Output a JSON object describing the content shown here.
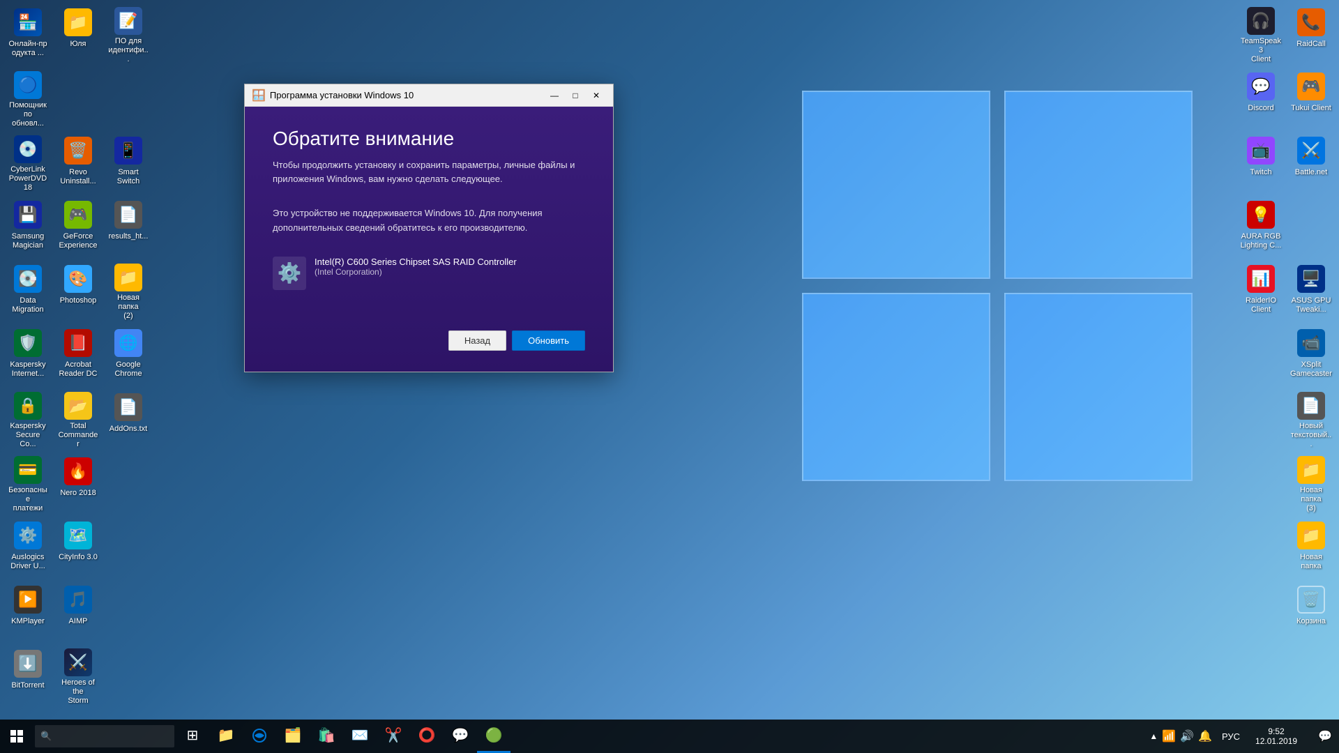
{
  "desktop": {
    "background_color": "#1a3a5c"
  },
  "icons_left": [
    {
      "id": "online",
      "label": "Онлайн-пр\nодукта ...",
      "emoji": "🏪",
      "color": "#003087"
    },
    {
      "id": "yulya",
      "label": "Юля",
      "emoji": "📁",
      "color": "#ffb900"
    },
    {
      "id": "software",
      "label": "ПО для\nидентифи...",
      "emoji": "🔑",
      "color": "#0078d7"
    },
    {
      "id": "helper",
      "label": "Помощник\nпо обновл...",
      "emoji": "🔵",
      "color": "#0078d7"
    },
    {
      "id": "empty1",
      "label": "",
      "emoji": "",
      "color": ""
    },
    {
      "id": "empty2",
      "label": "",
      "emoji": "",
      "color": ""
    },
    {
      "id": "cyberdvd",
      "label": "CyberLink\nPowerDVD 18",
      "emoji": "💿",
      "color": "#003087"
    },
    {
      "id": "revo",
      "label": "Revo\nUninstall...",
      "emoji": "🗑️",
      "color": "#e65c00"
    },
    {
      "id": "smartswitch",
      "label": "Smart Switch",
      "emoji": "📱",
      "color": "#1428a0"
    },
    {
      "id": "samsung",
      "label": "Samsung\nMagician",
      "emoji": "💾",
      "color": "#1428a0"
    },
    {
      "id": "geforce",
      "label": "GeForce\nExperience",
      "emoji": "🎮",
      "color": "#76b900"
    },
    {
      "id": "results",
      "label": "results_ht...",
      "emoji": "📄",
      "color": "#777"
    },
    {
      "id": "datamig",
      "label": "Data\nMigration",
      "emoji": "💽",
      "color": "#0078d7"
    },
    {
      "id": "photoshop",
      "label": "Photoshop",
      "emoji": "🎨",
      "color": "#31a8ff"
    },
    {
      "id": "newfolder2",
      "label": "Новая папка\n(2)",
      "emoji": "📁",
      "color": "#ffb900"
    },
    {
      "id": "kaspersky",
      "label": "Kaspersky\nInternet...",
      "emoji": "🛡️",
      "color": "#006d32"
    },
    {
      "id": "acrobat",
      "label": "Acrobat\nReader DC",
      "emoji": "📕",
      "color": "#b30b00"
    },
    {
      "id": "chrome",
      "label": "Google\nChrome",
      "emoji": "🌐",
      "color": "#0078d7"
    },
    {
      "id": "kaspersky2",
      "label": "Kaspersky\nSecure Co...",
      "emoji": "🔒",
      "color": "#006d32"
    },
    {
      "id": "total",
      "label": "Total\nCommander",
      "emoji": "📂",
      "color": "#f5c518"
    },
    {
      "id": "addons",
      "label": "AddOns.txt",
      "emoji": "📄",
      "color": "#777"
    },
    {
      "id": "bezop",
      "label": "Безопасные\nплатежи",
      "emoji": "💳",
      "color": "#006d32"
    },
    {
      "id": "nero",
      "label": "Nero 2018",
      "emoji": "🔥",
      "color": "#cc0000"
    },
    {
      "id": "empty3",
      "label": "",
      "emoji": "",
      "color": ""
    },
    {
      "id": "auslogics",
      "label": "Auslogics\nDriver U...",
      "emoji": "⚙️",
      "color": "#0078d7"
    },
    {
      "id": "cityinfo",
      "label": "CityInfo 3.0",
      "emoji": "🗺️",
      "color": "#00b4d8"
    },
    {
      "id": "empty4",
      "label": "",
      "emoji": "",
      "color": ""
    },
    {
      "id": "kmplayer",
      "label": "KMPlayer",
      "emoji": "▶️",
      "color": "#333"
    },
    {
      "id": "aimp",
      "label": "AIMP",
      "emoji": "🎵",
      "color": "#005fad"
    },
    {
      "id": "empty5",
      "label": "",
      "emoji": "",
      "color": ""
    },
    {
      "id": "bittorrent",
      "label": "BitTorrent",
      "emoji": "⬇️",
      "color": "#777"
    },
    {
      "id": "heroes",
      "label": "Heroes of the\nStorm",
      "emoji": "⚔️",
      "color": "#1a1a3a"
    }
  ],
  "icons_right": [
    {
      "id": "teamspeak",
      "label": "TeamSpeak 3\nClient",
      "emoji": "🎧",
      "color": "#1e1e2e"
    },
    {
      "id": "raidcall",
      "label": "RaidCall",
      "emoji": "📞",
      "color": "#e65c00"
    },
    {
      "id": "discord",
      "label": "Discord",
      "emoji": "💬",
      "color": "#5865f2"
    },
    {
      "id": "tukui",
      "label": "Tukui Client",
      "emoji": "🎮",
      "color": "#ff8c00"
    },
    {
      "id": "twitch",
      "label": "Twitch",
      "emoji": "📺",
      "color": "#9146ff"
    },
    {
      "id": "battlenet",
      "label": "Battle.net",
      "emoji": "⚔️",
      "color": "#0074e0"
    },
    {
      "id": "aura",
      "label": "AURA RGB\nLighting C...",
      "emoji": "💡",
      "color": "#cc0000"
    },
    {
      "id": "empty_r1",
      "label": "",
      "emoji": "",
      "color": ""
    },
    {
      "id": "raiderio",
      "label": "RaiderIO\nClient",
      "emoji": "📊",
      "color": "#e81123"
    },
    {
      "id": "asusgpu",
      "label": "ASUS GPU\nTweaki...",
      "emoji": "🖥️",
      "color": "#003087"
    },
    {
      "id": "empty_r2",
      "label": "",
      "emoji": "",
      "color": ""
    },
    {
      "id": "xsplit",
      "label": "XSplit\nGamecaster",
      "emoji": "📹",
      "color": "#005fad"
    },
    {
      "id": "empty_r3",
      "label": "",
      "emoji": "",
      "color": ""
    },
    {
      "id": "newfolder3_item",
      "label": "Новый\nтекстовый...",
      "emoji": "📄",
      "color": "#777"
    },
    {
      "id": "empty_r4",
      "label": "",
      "emoji": "",
      "color": ""
    },
    {
      "id": "newfolder_r",
      "label": "Новая папка\n(3)",
      "emoji": "📁",
      "color": "#ffb900"
    },
    {
      "id": "empty_r5",
      "label": "",
      "emoji": "",
      "color": ""
    },
    {
      "id": "newfolder2_r",
      "label": "Новая папка",
      "emoji": "📁",
      "color": "#ffb900"
    },
    {
      "id": "empty_r6",
      "label": "",
      "emoji": "",
      "color": ""
    },
    {
      "id": "recycle",
      "label": "Корзина",
      "emoji": "🗑️",
      "color": "#aaa"
    }
  ],
  "dialog": {
    "title": "Программа установки Windows 10",
    "heading": "Обратите внимание",
    "subtext": "Чтобы продолжить установку и сохранить параметры, личные файлы и приложения Windows, вам нужно сделать следующее.",
    "body_text": "Это устройство не поддерживается Windows 10. Для получения дополнительных сведений обратитесь к его производителю.",
    "device_name": "Intel(R) C600 Series Chipset SAS RAID Controller",
    "device_maker": "(Intel Corporation)",
    "btn_back": "Назад",
    "btn_update": "Обновить"
  },
  "taskbar": {
    "start_icon": "⊞",
    "search_placeholder": "🔍",
    "time": "9:52",
    "date": "12.01.2019",
    "language": "РУС",
    "items": [
      {
        "id": "file-explorer",
        "emoji": "📁"
      },
      {
        "id": "edge",
        "emoji": "🌐"
      },
      {
        "id": "files",
        "emoji": "🗂️"
      },
      {
        "id": "store",
        "emoji": "🛍️"
      },
      {
        "id": "mail",
        "emoji": "✉️"
      },
      {
        "id": "snip",
        "emoji": "✂️"
      },
      {
        "id": "opera",
        "emoji": "🔴"
      },
      {
        "id": "teams",
        "emoji": "💬"
      },
      {
        "id": "active-item",
        "emoji": "🟢"
      }
    ]
  }
}
